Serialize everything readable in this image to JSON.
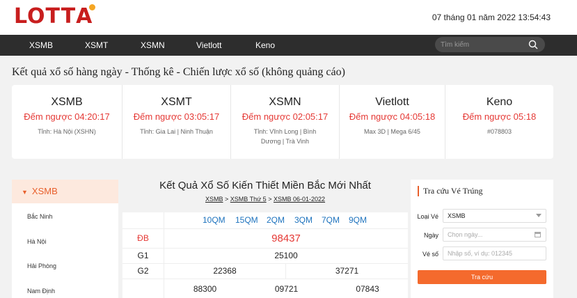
{
  "header": {
    "logo_text": "LOTT",
    "logo_last": "A",
    "datetime": "07 tháng 01 năm 2022 13:54:43"
  },
  "nav": {
    "items": [
      "XSMB",
      "XSMT",
      "XSMN",
      "Vietlott",
      "Keno"
    ],
    "search_placeholder": "Tìm kiếm",
    "search_icon": "search-icon"
  },
  "tagline": "Kết quả xổ số hàng ngày - Thống kê - Chiến lược xổ số (không quảng cáo)",
  "summary": [
    {
      "title": "XSMB",
      "countdown": "Đếm ngược 04:20:17",
      "sub": "Tỉnh: Hà Nội (XSHN)"
    },
    {
      "title": "XSMT",
      "countdown": "Đếm ngược 03:05:17",
      "sub": "Tỉnh: Gia Lai | Ninh Thuận"
    },
    {
      "title": "XSMN",
      "countdown": "Đếm ngược 02:05:17",
      "sub": "Tỉnh: Vĩnh Long | Bình Dương | Trà Vinh"
    },
    {
      "title": "Vietlott",
      "countdown": "Đếm ngược 04:05:18",
      "sub": "Max 3D | Mega 6/45"
    },
    {
      "title": "Keno",
      "countdown": "Đếm ngược 05:18",
      "sub": "#078803"
    }
  ],
  "sidebar": {
    "head": "XSMB",
    "items": [
      "Bắc Ninh",
      "Hà Nội",
      "Hải Phòng",
      "Nam Định"
    ]
  },
  "results": {
    "title": "Kết Quả Xổ Số Kiến Thiết Miền Bắc Mới Nhất",
    "breadcrumb": [
      "XSMB",
      "XSMB Thứ 5",
      "XSMB 06-01-2022"
    ],
    "breadcrumb_sep": ">",
    "quick_links": [
      "10QM",
      "15QM",
      "2QM",
      "3QM",
      "7QM",
      "9QM"
    ],
    "db_label": "ĐB",
    "db_value": "98437",
    "g1_label": "G1",
    "g1_value": "25100",
    "g2_label": "G2",
    "g2_values": [
      "22368",
      "37271"
    ],
    "g3_values": [
      "88300",
      "09721",
      "07843"
    ]
  },
  "lookup": {
    "title": "Tra cứu Vé Trúng",
    "ticket_type_label": "Loại Vé",
    "ticket_type_value": "XSMB",
    "date_label": "Ngày",
    "date_placeholder": "Chọn ngày...",
    "number_label": "Vé số",
    "number_placeholder": "Nhập số, ví dụ: 012345",
    "button": "Tra cứu"
  },
  "colors": {
    "brand": "#c81e1e",
    "accent": "#f46a2d",
    "countdown": "#e53935",
    "link": "#1e73be",
    "nav_bg": "#2d2d2d"
  }
}
